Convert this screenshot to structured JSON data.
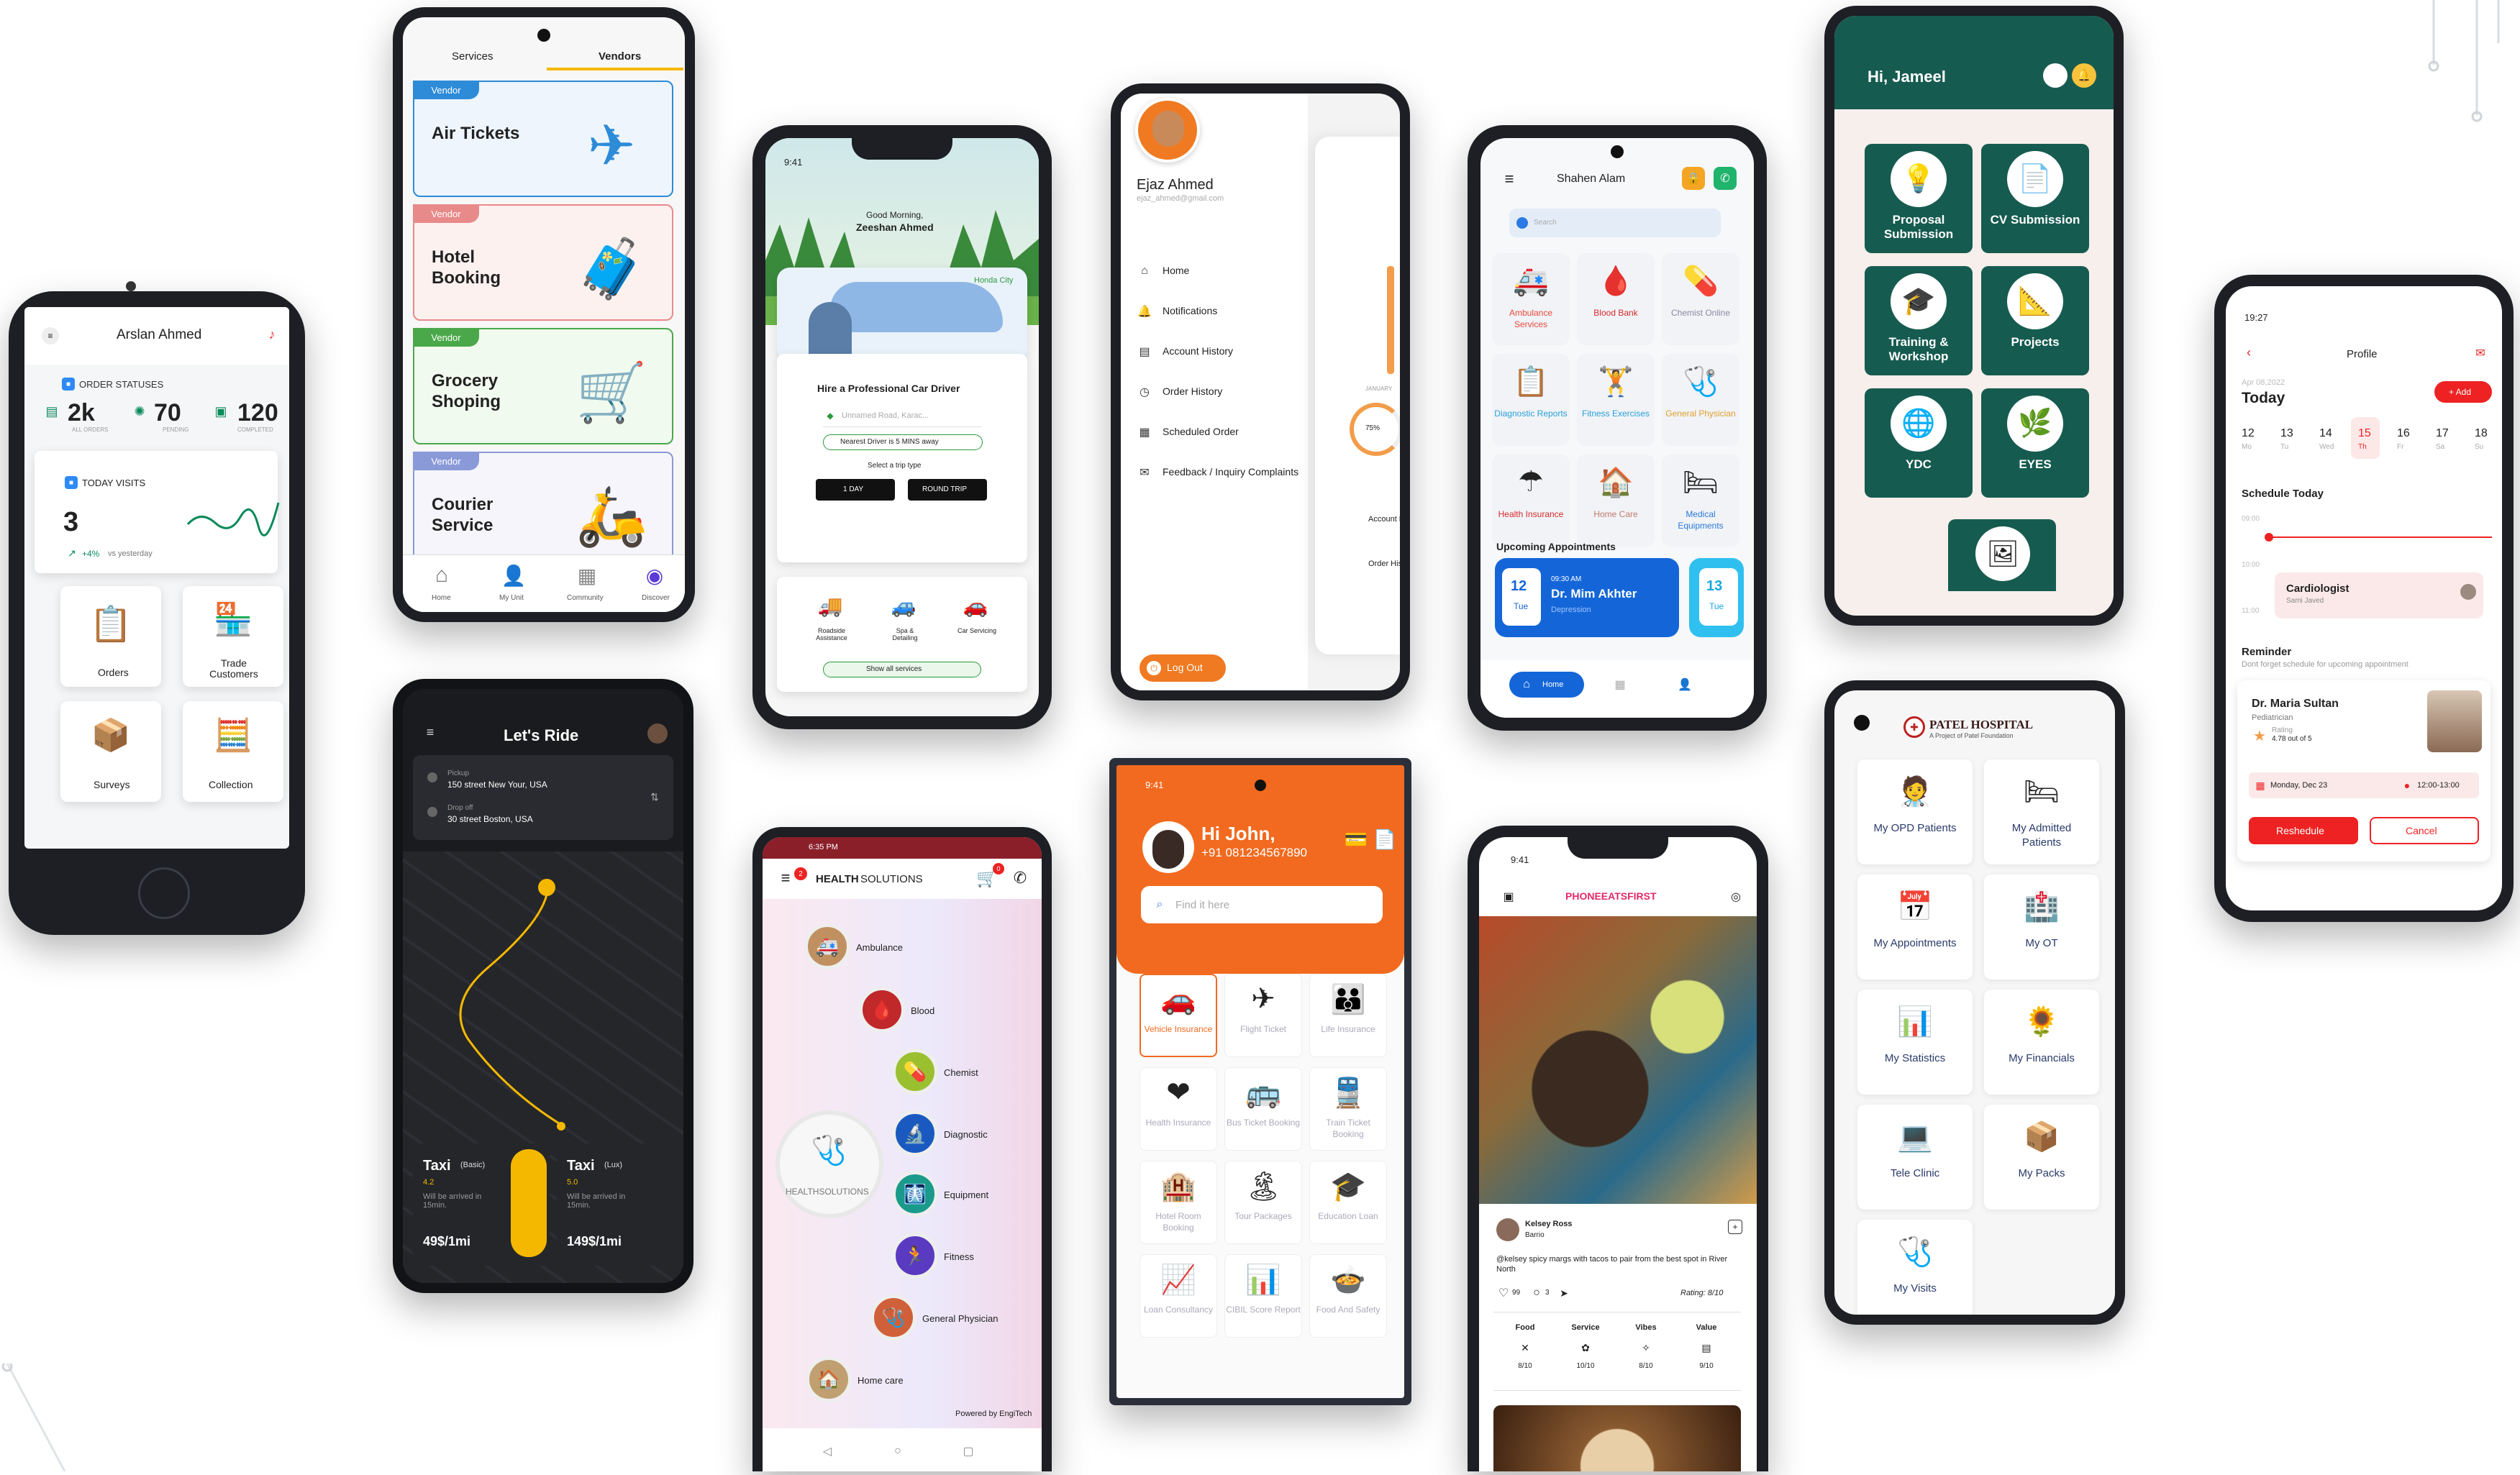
{
  "p1": {
    "user": "Arslan Ahmed",
    "section": "ORDER STATUSES",
    "stats": [
      {
        "v": "2k",
        "l": "ALL ORDERS"
      },
      {
        "v": "70",
        "l": "PENDING"
      },
      {
        "v": "120",
        "l": "COMPLETED"
      }
    ],
    "visits_label": "TODAY VISITS",
    "visits": "3",
    "delta": "+4%",
    "delta_note": "vs yesterday",
    "tiles": [
      "Orders",
      "Trade Customers",
      "Surveys",
      "Collection"
    ]
  },
  "p2": {
    "tabs": [
      "Services",
      "Vendors"
    ],
    "badge": "Vendor",
    "cards": [
      "Air Tickets",
      "Hotel Booking",
      "Grocery Shoping",
      "Courier Service"
    ],
    "nav": [
      "Home",
      "My Unit",
      "Community",
      "Discover"
    ]
  },
  "p3": {
    "time": "9:41",
    "greet": "Good Morning,",
    "name": "Zeeshan Ahmed",
    "car": "Honda City",
    "heading": "Hire a Professional Car Driver",
    "placeholder": "Unnamed Road, Karac...",
    "nearest": "Nearest Driver is 5 MINS away",
    "trip": "Select a trip type",
    "btn1": "1 DAY",
    "btn2": "ROUND TRIP",
    "services": [
      "Roadside Assistance",
      "Spa & Detailing",
      "Car Servicing"
    ],
    "show_all": "Show all services"
  },
  "p4": {
    "name": "Ejaz Ahmed",
    "email": "ejaz_ahmed@gmail.com",
    "menu": [
      "Home",
      "Notifications",
      "Account History",
      "Order History",
      "Scheduled Order",
      "Feedback / Inquiry Complaints"
    ],
    "logout": "Log Out",
    "peek": [
      "Account History",
      "Order History",
      "75%",
      "JANUARY"
    ]
  },
  "p5": {
    "user": "Shahen Alam",
    "search": "Search",
    "tiles": [
      "Ambulance Services",
      "Blood Bank",
      "Chemist Online",
      "Diagnostic Reports",
      "Fitness Exercises",
      "General Physician",
      "Health Insurance",
      "Home Care",
      "Medical Equipments"
    ],
    "upcoming": "Upcoming Appointments",
    "appt_day": "12",
    "appt_dow": "Tue",
    "appt_time": "09:30 AM",
    "appt_doc": "Dr. Mim Akhter",
    "appt_spec": "Depression",
    "appt2_day": "13",
    "appt2_dow": "Tue",
    "nav": "Home"
  },
  "p6": {
    "greet": "Hi, Jameel",
    "tiles": [
      "Proposal Submission",
      "CV Submission",
      "Training & Workshop",
      "Projects",
      "YDC",
      "EYES"
    ]
  },
  "p7": {
    "time": "19:27",
    "title": "Profile",
    "date": "Apr 08,2022",
    "today": "Today",
    "add": "+ Add",
    "days": [
      {
        "n": "12",
        "d": "Mo"
      },
      {
        "n": "13",
        "d": "Tu"
      },
      {
        "n": "14",
        "d": "Wed"
      },
      {
        "n": "15",
        "d": "Th"
      },
      {
        "n": "16",
        "d": "Fr"
      },
      {
        "n": "17",
        "d": "Sa"
      },
      {
        "n": "18",
        "d": "Su"
      }
    ],
    "schedule": "Schedule Today",
    "times": [
      "09:00",
      "10:00",
      "11:00"
    ],
    "appt": "Cardiologist",
    "appt_sub": "Sami Javed",
    "reminder": "Reminder",
    "reminder_sub": "Dont forget schedule for upcoming appointment",
    "doctor": "Dr. Maria Sultan",
    "spec": "Pediatrician",
    "rating": "Rating",
    "rating_val": "4.78 out of 5",
    "date2": "Monday, Dec 23",
    "time2": "12:00-13:00",
    "btn1": "Reshedule",
    "btn2": "Cancel"
  },
  "p8": {
    "title": "Let's Ride",
    "pickup_l": "Pickup",
    "pickup": "150 street New Your, USA",
    "drop_l": "Drop off",
    "drop": "30 street Boston, USA",
    "taxi1": "Taxi",
    "taxi1_t": "(Basic)",
    "taxi1_r": "4.2",
    "taxi1_n": "Will be arrived in 15min.",
    "taxi1_p": "49$/1mi",
    "taxi2": "Taxi",
    "taxi2_t": "(Lux)",
    "taxi2_r": "5.0",
    "taxi2_n": "Will be arrived in 15min.",
    "taxi2_p": "149$/1mi"
  },
  "p9": {
    "status": "6:35 PM",
    "brand": "HEALTH",
    "brand2": "SOLUTIONS",
    "items": [
      "Ambulance",
      "Blood",
      "Chemist",
      "Diagnostic",
      "Equipment",
      "Fitness",
      "General Physician",
      "Home care"
    ],
    "center": "HEALTHSOLUTIONS",
    "footer": "Powered by EngiTech",
    "cart_count": "0",
    "notif": "2"
  },
  "p10": {
    "time": "9:41",
    "greet": "Hi John,",
    "phone": "+91 081234567890",
    "search": "Find it here",
    "tiles": [
      "Vehicle Insurance",
      "Flight Ticket",
      "Life Insurance",
      "Health Insurance",
      "Bus Ticket Booking",
      "Train Ticket Booking",
      "Hotel Room Booking",
      "Tour Packages",
      "Education Loan",
      "Loan Consultancy",
      "CIBIL Score Report",
      "Food And Safety"
    ]
  },
  "p11": {
    "time": "9:41",
    "brand": "PHONEEATSFIRST",
    "user": "Kelsey Ross",
    "place": "Barrio",
    "post": "@kelsey spicy margs with tacos to pair from the best spot in River North",
    "likes": "99",
    "comments": "3",
    "rating": "Rating: 8/10",
    "metrics": [
      {
        "l": "Food",
        "v": "8/10"
      },
      {
        "l": "Service",
        "v": "10/10"
      },
      {
        "l": "Vibes",
        "v": "8/10"
      },
      {
        "l": "Value",
        "v": "9/10"
      }
    ]
  },
  "p12": {
    "name": "PATEL HOSPITAL",
    "sub": "A Project of Patel Foundation",
    "tiles": [
      "My OPD Patients",
      "My Admitted Patients",
      "My Appointments",
      "My OT",
      "My Statistics",
      "My Financials",
      "Tele Clinic",
      "My Packs",
      "My Visits"
    ]
  }
}
